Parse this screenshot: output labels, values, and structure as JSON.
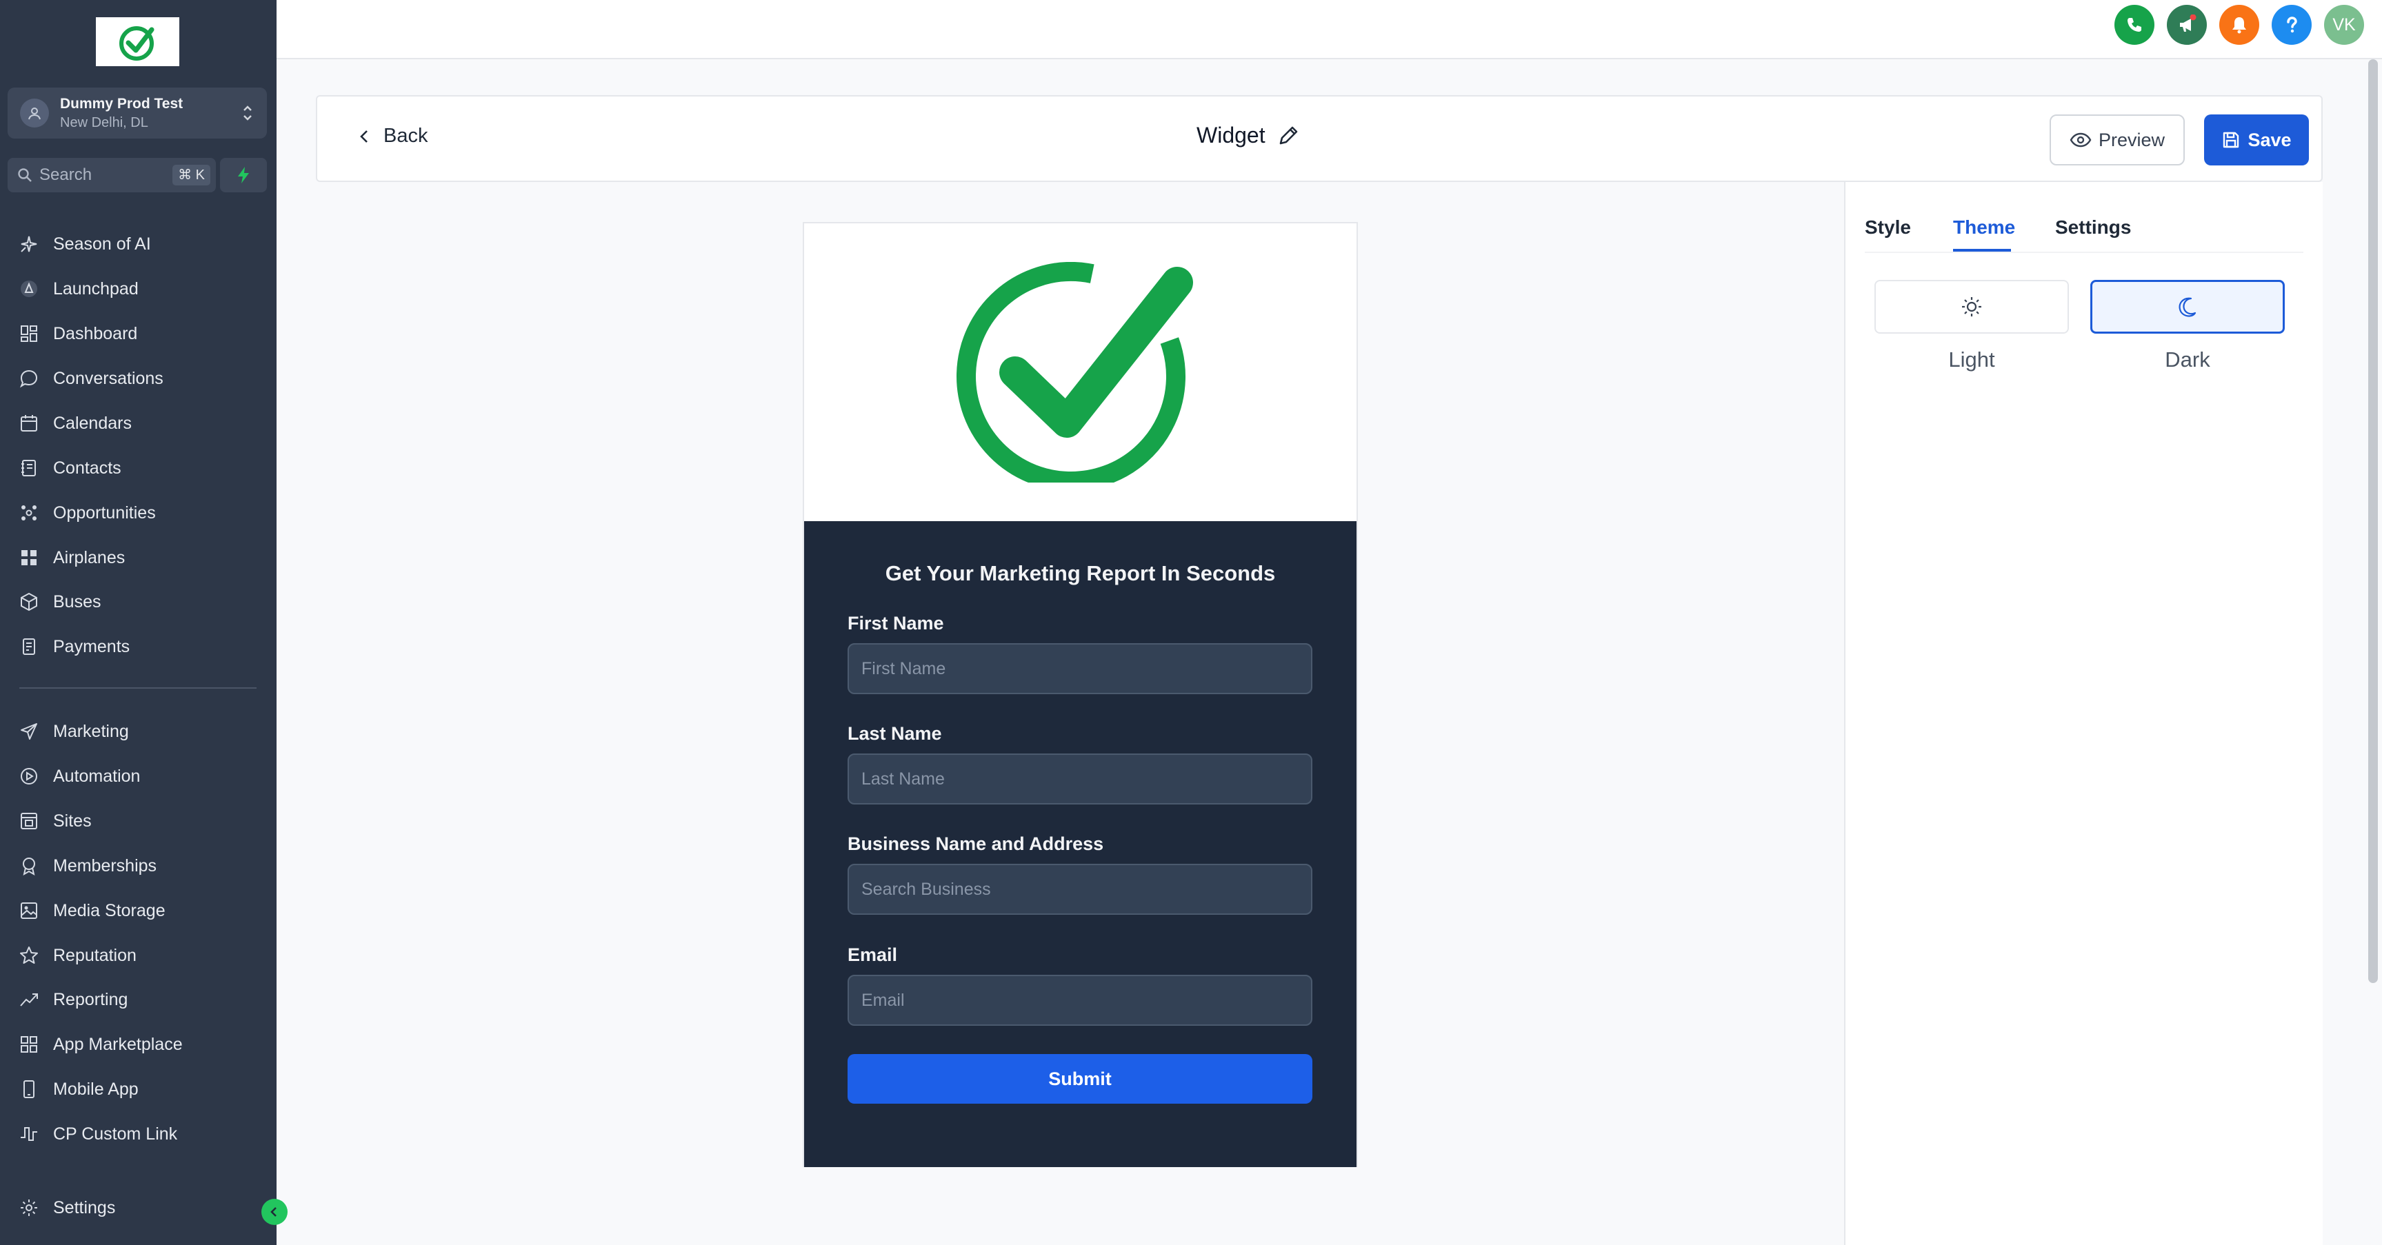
{
  "sidebar": {
    "account": {
      "name": "Dummy Prod Test",
      "location": "New Delhi, DL"
    },
    "search": {
      "placeholder": "Search",
      "shortcut": "⌘ K"
    },
    "items": [
      {
        "label": "Season of AI",
        "icon": "sparkle-icon"
      },
      {
        "label": "Launchpad",
        "icon": "rocket-icon"
      },
      {
        "label": "Dashboard",
        "icon": "grid-icon"
      },
      {
        "label": "Conversations",
        "icon": "chat-bubble-icon"
      },
      {
        "label": "Calendars",
        "icon": "calendar-icon"
      },
      {
        "label": "Contacts",
        "icon": "contact-book-icon"
      },
      {
        "label": "Opportunities",
        "icon": "network-icon"
      },
      {
        "label": "Airplanes",
        "icon": "blocks-icon"
      },
      {
        "label": "Buses",
        "icon": "box-icon"
      },
      {
        "label": "Payments",
        "icon": "receipt-icon"
      }
    ],
    "items2": [
      {
        "label": "Marketing",
        "icon": "send-icon"
      },
      {
        "label": "Automation",
        "icon": "automation-icon"
      },
      {
        "label": "Sites",
        "icon": "site-icon"
      },
      {
        "label": "Memberships",
        "icon": "badge-icon"
      },
      {
        "label": "Media Storage",
        "icon": "image-icon"
      },
      {
        "label": "Reputation",
        "icon": "star-icon"
      },
      {
        "label": "Reporting",
        "icon": "trend-icon"
      },
      {
        "label": "App Marketplace",
        "icon": "apps-icon"
      },
      {
        "label": "Mobile App",
        "icon": "phone-device-icon"
      },
      {
        "label": "CP Custom Link",
        "icon": "pulse-icon"
      }
    ],
    "settings_label": "Settings"
  },
  "topbar": {
    "avatar_initials": "VK"
  },
  "header": {
    "back_label": "Back",
    "title": "Widget",
    "preview_label": "Preview",
    "save_label": "Save"
  },
  "panel": {
    "tabs": [
      "Style",
      "Theme",
      "Settings"
    ],
    "active_tab": "Theme",
    "theme_options": [
      "Light",
      "Dark"
    ],
    "selected_theme": "Dark"
  },
  "widget": {
    "heading": "Get Your Marketing Report In Seconds",
    "fields": [
      {
        "label": "First Name",
        "placeholder": "First Name"
      },
      {
        "label": "Last Name",
        "placeholder": "Last Name"
      },
      {
        "label": "Business Name and Address",
        "placeholder": "Search Business"
      },
      {
        "label": "Email",
        "placeholder": "Email"
      }
    ],
    "submit_label": "Submit"
  },
  "colors": {
    "sidebar_bg": "#2d3748",
    "primary": "#1d5bd8",
    "form_bg": "#1e293b",
    "brand_green": "#16a34a"
  }
}
